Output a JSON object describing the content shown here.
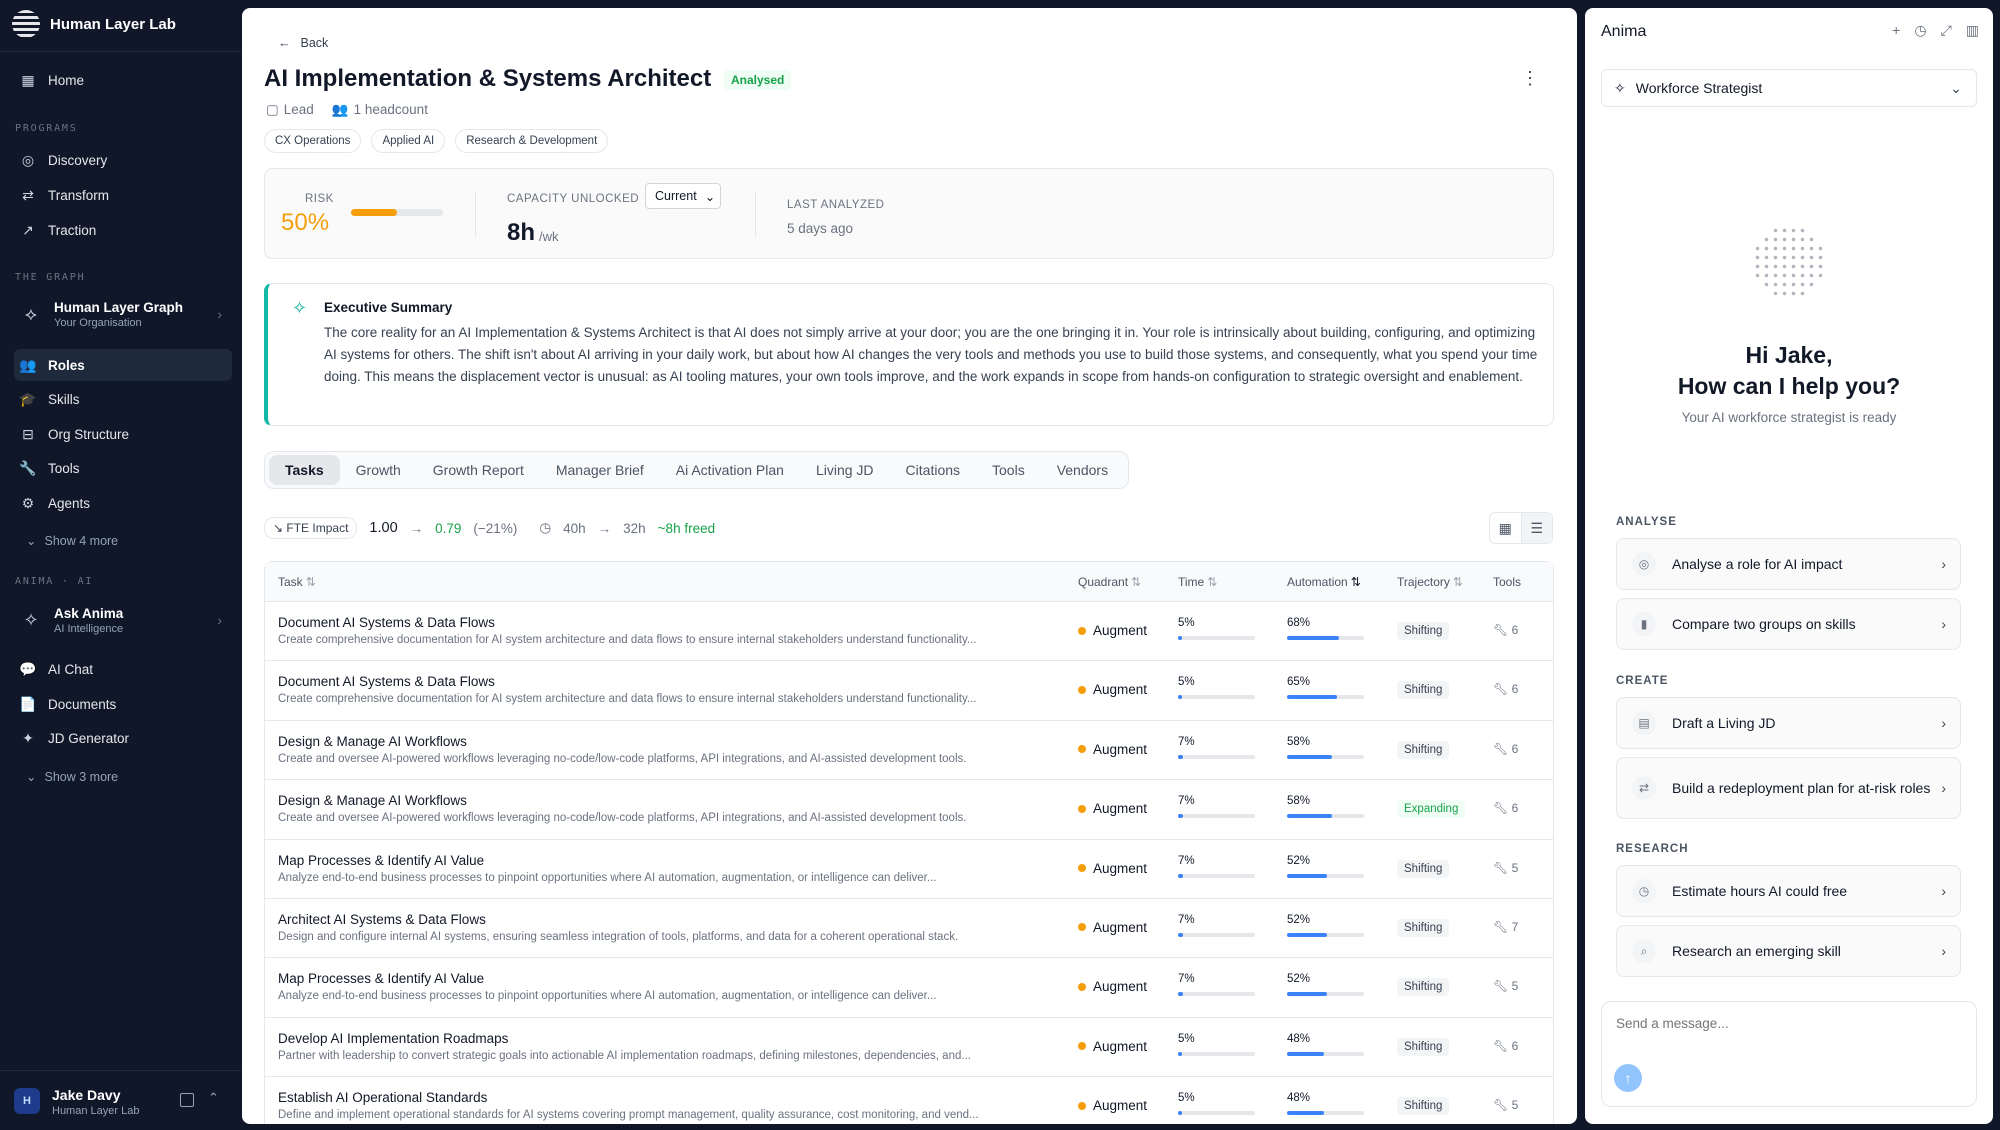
{
  "sidebar": {
    "brand": "Human Layer Lab",
    "home": "Home",
    "programs_label": "PROGRAMS",
    "programs": [
      "Discovery",
      "Transform",
      "Traction"
    ],
    "graph_label": "THE GRAPH",
    "graph": {
      "title": "Human Layer Graph",
      "subtitle": "Your Organisation"
    },
    "graph_items": [
      "Roles",
      "Skills",
      "Org Structure",
      "Tools",
      "Agents"
    ],
    "graph_more": "Show 4 more",
    "ai_label": "ANIMA · AI",
    "ask": {
      "title": "Ask Anima",
      "subtitle": "AI Intelligence"
    },
    "ai_items": [
      "AI Chat",
      "Documents",
      "JD Generator"
    ],
    "ai_more": "Show 3 more",
    "user": {
      "initial": "H",
      "name": "Jake Davy",
      "org": "Human Layer Lab"
    }
  },
  "header": {
    "back": "Back",
    "title": "AI Implementation & Systems Architect",
    "status": "Analysed",
    "level": "Lead",
    "headcount": "1 headcount",
    "chips": [
      "CX Operations",
      "Applied AI",
      "Research & Development"
    ]
  },
  "stats": {
    "risk_label": "RISK",
    "risk_value": "50%",
    "risk_fraction": 0.5,
    "capacity_label": "CAPACITY UNLOCKED",
    "capacity_select": "Current",
    "capacity_value": "8h",
    "capacity_unit": "/wk",
    "last_label": "LAST ANALYZED",
    "last_value": "5 days ago"
  },
  "summary": {
    "title": "Executive Summary",
    "text": "The core reality for an AI Implementation & Systems Architect is that AI does not simply arrive at your door; you are the one bringing it in. Your role is intrinsically about building, configuring, and optimizing AI systems for others. The shift isn't about AI arriving in your daily work, but about how AI changes the very tools and methods you use to build those systems, and consequently, what you spend your time doing. This means the displacement vector is unusual: as AI tooling matures, your own tools improve, and the work expands in scope from hands-on configuration to strategic oversight and enablement."
  },
  "tabs": [
    "Tasks",
    "Growth",
    "Growth Report",
    "Manager Brief",
    "Ai Activation Plan",
    "Living JD",
    "Citations",
    "Tools",
    "Vendors"
  ],
  "fte": {
    "chip": "FTE Impact",
    "from": "1.00",
    "arrow": "→",
    "to": "0.79",
    "delta": "(−21%)",
    "hours_from": "40h",
    "hours_to": "32h",
    "freed": "~8h freed"
  },
  "table": {
    "headers": {
      "task": "Task",
      "quadrant": "Quadrant",
      "time": "Time",
      "automation": "Automation",
      "trajectory": "Trajectory",
      "tools": "Tools"
    },
    "rows": [
      {
        "title": "Document AI Systems & Data Flows",
        "desc": "Create comprehensive documentation for AI system architecture and data flows to ensure internal stakeholders understand functionality...",
        "quadrant": "Augment",
        "time": "5%",
        "time_frac": 0.05,
        "automation": "68%",
        "auto_frac": 0.68,
        "trajectory": "Shifting",
        "tools": "6"
      },
      {
        "title": "Document AI Systems & Data Flows",
        "desc": "Create comprehensive documentation for AI system architecture and data flows to ensure internal stakeholders understand functionality...",
        "quadrant": "Augment",
        "time": "5%",
        "time_frac": 0.05,
        "automation": "65%",
        "auto_frac": 0.65,
        "trajectory": "Shifting",
        "tools": "6"
      },
      {
        "title": "Design & Manage AI Workflows",
        "desc": "Create and oversee AI-powered workflows leveraging no-code/low-code platforms, API integrations, and AI-assisted development tools.",
        "quadrant": "Augment",
        "time": "7%",
        "time_frac": 0.07,
        "automation": "58%",
        "auto_frac": 0.58,
        "trajectory": "Shifting",
        "tools": "6"
      },
      {
        "title": "Design & Manage AI Workflows",
        "desc": "Create and oversee AI-powered workflows leveraging no-code/low-code platforms, API integrations, and AI-assisted development tools.",
        "quadrant": "Augment",
        "time": "7%",
        "time_frac": 0.07,
        "automation": "58%",
        "auto_frac": 0.58,
        "trajectory": "Expanding",
        "tools": "6"
      },
      {
        "title": "Map Processes & Identify AI Value",
        "desc": "Analyze end-to-end business processes to pinpoint opportunities where AI automation, augmentation, or intelligence can deliver...",
        "quadrant": "Augment",
        "time": "7%",
        "time_frac": 0.07,
        "automation": "52%",
        "auto_frac": 0.52,
        "trajectory": "Shifting",
        "tools": "5"
      },
      {
        "title": "Architect AI Systems & Data Flows",
        "desc": "Design and configure internal AI systems, ensuring seamless integration of tools, platforms, and data for a coherent operational stack.",
        "quadrant": "Augment",
        "time": "7%",
        "time_frac": 0.07,
        "automation": "52%",
        "auto_frac": 0.52,
        "trajectory": "Shifting",
        "tools": "7"
      },
      {
        "title": "Map Processes & Identify AI Value",
        "desc": "Analyze end-to-end business processes to pinpoint opportunities where AI automation, augmentation, or intelligence can deliver...",
        "quadrant": "Augment",
        "time": "7%",
        "time_frac": 0.07,
        "automation": "52%",
        "auto_frac": 0.52,
        "trajectory": "Shifting",
        "tools": "5"
      },
      {
        "title": "Develop AI Implementation Roadmaps",
        "desc": "Partner with leadership to convert strategic goals into actionable AI implementation roadmaps, defining milestones, dependencies, and...",
        "quadrant": "Augment",
        "time": "5%",
        "time_frac": 0.05,
        "automation": "48%",
        "auto_frac": 0.48,
        "trajectory": "Shifting",
        "tools": "6"
      },
      {
        "title": "Establish AI Operational Standards",
        "desc": "Define and implement operational standards for AI systems covering prompt management, quality assurance, cost monitoring, and vend...",
        "quadrant": "Augment",
        "time": "5%",
        "time_frac": 0.05,
        "automation": "48%",
        "auto_frac": 0.48,
        "trajectory": "Shifting",
        "tools": "5"
      }
    ]
  },
  "anima": {
    "title": "Anima",
    "persona": "Workforce Strategist",
    "greeting_1": "Hi Jake,",
    "greeting_2": "How can I help you?",
    "subtitle": "Your AI workforce strategist is ready",
    "sections": [
      {
        "label": "ANALYSE",
        "items": [
          "Analyse a role for AI impact",
          "Compare two groups on skills"
        ]
      },
      {
        "label": "CREATE",
        "items": [
          "Draft a Living JD",
          "Build a redeployment plan for at-risk roles"
        ]
      },
      {
        "label": "RESEARCH",
        "items": [
          "Estimate hours AI could free",
          "Research an emerging skill"
        ]
      }
    ],
    "placeholder": "Send a message..."
  },
  "colors": {
    "accent": "#3b82f6",
    "risk": "#f59e0b",
    "success": "#16a34a",
    "summary_border": "#14b8a6",
    "sidebar_bg": "#0f1729"
  }
}
